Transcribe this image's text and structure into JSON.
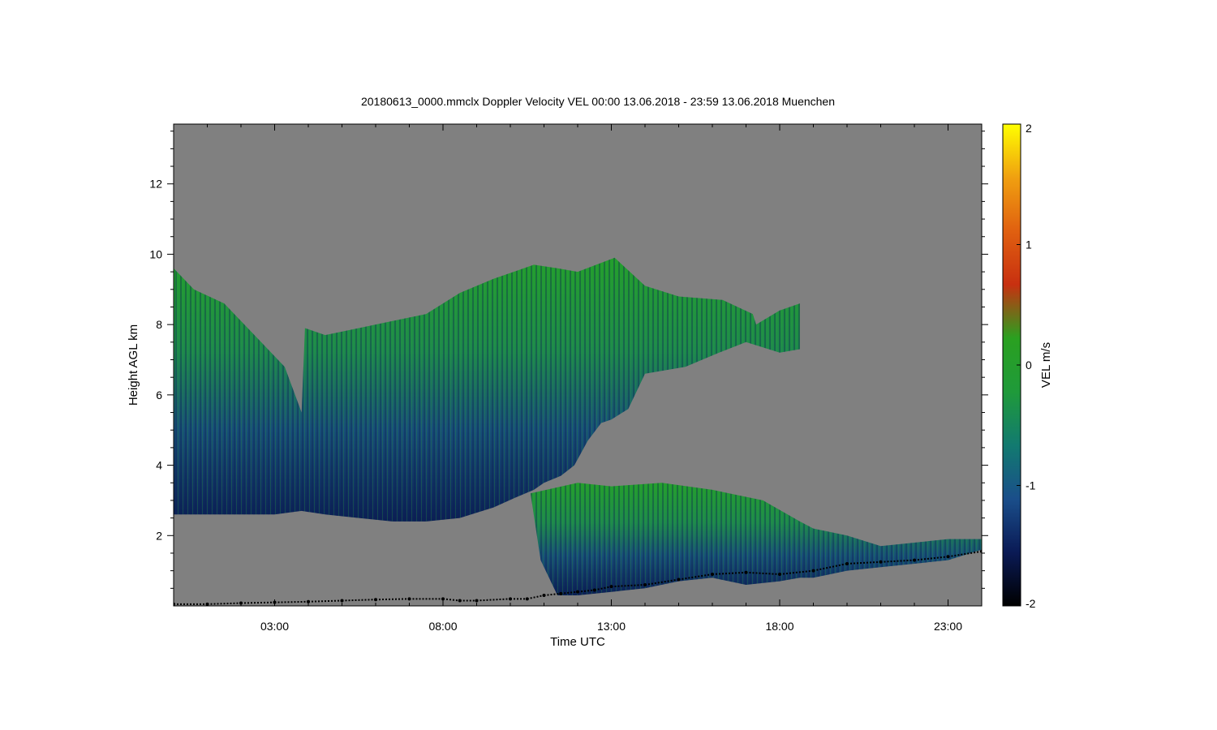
{
  "chart_data": {
    "type": "heatmap",
    "title": "20180613_0000.mmclx Doppler Velocity VEL   00:00 13.06.2018 - 23:59 13.06.2018 Muenchen",
    "xlabel": "Time UTC",
    "ylabel": "Height AGL km",
    "x_unit": "hours UTC",
    "xlim": [
      0,
      24
    ],
    "ylim": [
      0,
      13.7
    ],
    "x_ticks": [
      3,
      8,
      13,
      18,
      23
    ],
    "x_tick_labels": [
      "03:00",
      "08:00",
      "13:00",
      "18:00",
      "23:00"
    ],
    "y_ticks": [
      2,
      4,
      6,
      8,
      10,
      12
    ],
    "y_tick_labels": [
      "2",
      "4",
      "6",
      "8",
      "10",
      "12"
    ],
    "background_color": "#808080",
    "colorbar": {
      "label": "VEL m/s",
      "range": [
        -2,
        2
      ],
      "ticks": [
        -2,
        -1,
        0,
        1,
        2
      ],
      "tick_labels": [
        "-2",
        "-1",
        "0",
        "1",
        "2"
      ],
      "colors": [
        "#000000",
        "#0a1a55",
        "#1a4e8a",
        "#127a70",
        "#1f9a3a",
        "#2aa020",
        "#c83010",
        "#e06010",
        "#f0a010",
        "#ffff00"
      ]
    },
    "cloud_regions": [
      {
        "name": "deep cloud",
        "x": [
          0,
          0.6,
          1.5,
          2.5,
          3.3,
          3.8,
          3.9,
          4.5,
          5.5,
          6.5,
          7.5,
          8.5,
          9.5,
          10.7,
          11.4,
          12.0,
          13.1,
          14.0,
          15.0,
          16.3,
          17.2,
          17.3,
          18.0,
          18.6,
          18.6,
          18.0,
          17.0,
          16.2,
          15.2,
          14.0,
          13.5,
          13.0,
          12.7,
          12.3,
          11.9,
          11.5,
          11.0,
          10.7,
          10.2,
          9.5,
          8.5,
          7.5,
          6.5,
          5.5,
          4.5,
          3.8,
          3.0,
          2.0,
          1.0,
          0
        ],
        "y": [
          9.6,
          9.0,
          8.6,
          7.6,
          6.8,
          5.5,
          7.9,
          7.7,
          7.9,
          8.1,
          8.3,
          8.9,
          9.3,
          9.7,
          9.6,
          9.5,
          9.9,
          9.1,
          8.8,
          8.7,
          8.3,
          8.0,
          8.4,
          8.6,
          7.3,
          7.2,
          7.5,
          7.2,
          6.8,
          6.6,
          5.6,
          5.3,
          5.2,
          4.7,
          4.0,
          3.7,
          3.5,
          3.3,
          3.1,
          2.8,
          2.5,
          2.4,
          2.4,
          2.5,
          2.6,
          2.7,
          2.6,
          2.6,
          2.6,
          2.6
        ]
      },
      {
        "name": "mid cloud",
        "x": [
          10.6,
          12.0,
          13.0,
          14.5,
          16.0,
          17.5,
          18.6,
          19.0,
          20.0,
          21.0,
          22.0,
          23.0,
          24.0,
          24.0,
          23.0,
          22.0,
          21.0,
          20.0,
          19.0,
          18.6,
          18.0,
          17.0,
          16.0,
          15.0,
          14.0,
          13.0,
          12.0,
          11.4,
          10.9
        ],
        "y": [
          3.2,
          3.5,
          3.4,
          3.5,
          3.3,
          3.0,
          2.4,
          2.2,
          2.0,
          1.7,
          1.8,
          1.9,
          1.9,
          1.6,
          1.3,
          1.2,
          1.1,
          1.0,
          0.8,
          0.8,
          0.7,
          0.6,
          0.8,
          0.7,
          0.5,
          0.4,
          0.3,
          0.3,
          1.3
        ]
      }
    ],
    "ceilometer_points": {
      "x": [
        0,
        1,
        2,
        3,
        4,
        5,
        6,
        7,
        8,
        8.5,
        9,
        10,
        10.5,
        11,
        11.5,
        12,
        12.5,
        13,
        14,
        15,
        16,
        17,
        18,
        19,
        20,
        21,
        22,
        23,
        24
      ],
      "y": [
        0.05,
        0.05,
        0.08,
        0.1,
        0.12,
        0.15,
        0.18,
        0.2,
        0.2,
        0.15,
        0.15,
        0.2,
        0.2,
        0.3,
        0.35,
        0.4,
        0.45,
        0.55,
        0.6,
        0.75,
        0.9,
        0.95,
        0.9,
        1.0,
        1.2,
        1.25,
        1.3,
        1.4,
        1.55
      ]
    }
  }
}
